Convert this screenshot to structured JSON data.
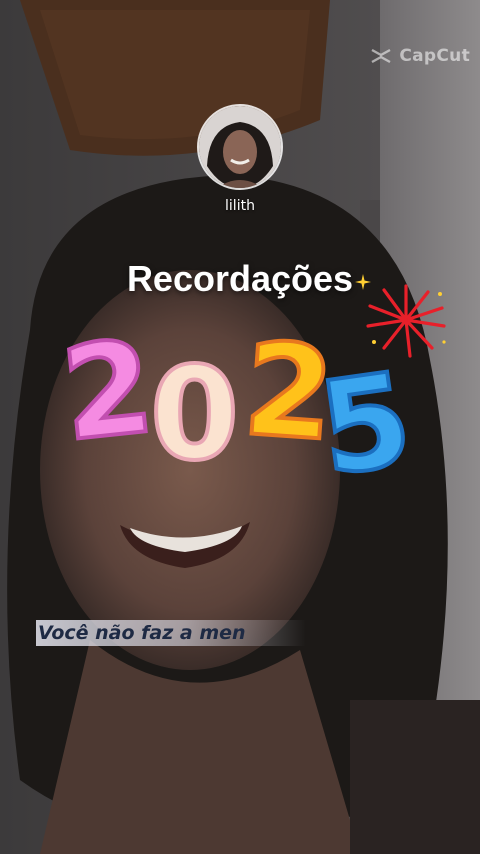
{
  "watermark": {
    "text": "CapCut",
    "icon": "capcut-logo-icon"
  },
  "profile": {
    "username": "lilith",
    "avatar_icon": "profile-avatar"
  },
  "overlay": {
    "title": "Recordações",
    "year_digits": [
      "2",
      "0",
      "2",
      "5"
    ],
    "year_colors": [
      "#f58be2",
      "#fbe3d0",
      "#ffc21a",
      "#3aa6ef"
    ],
    "sparkle_icon": "sparkle-icon",
    "fireworks_icon": "fireworks-icon"
  },
  "caption": {
    "text": "Você não faz a men"
  },
  "colors": {
    "caption_text": "#1e2a44",
    "fireworks": "#e8202a"
  }
}
